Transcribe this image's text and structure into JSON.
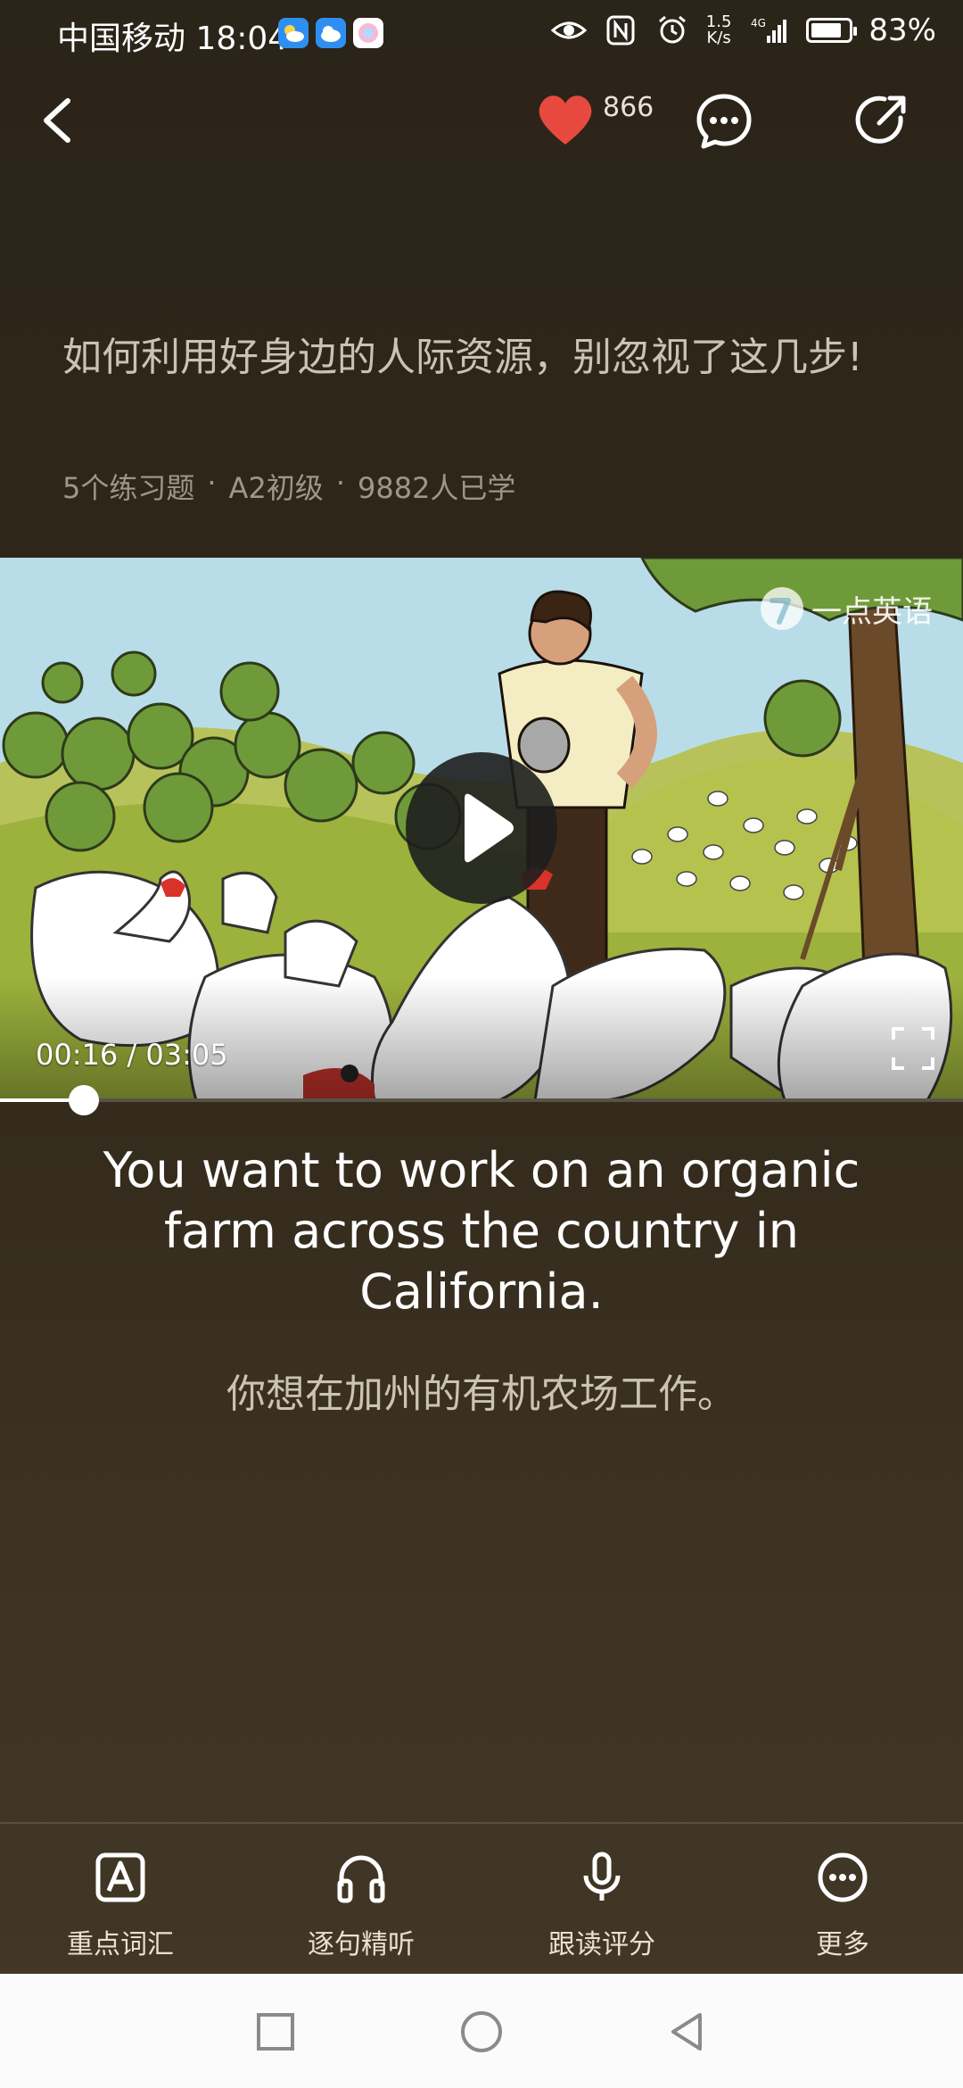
{
  "status_bar": {
    "carrier": "中国移动",
    "time": "18:04",
    "net_speed_value": "1.5",
    "net_speed_unit": "K/s",
    "battery_percent": "83%",
    "battery_level": 0.83,
    "icons": [
      "weather-app-icon",
      "cloud-app-icon",
      "photo-app-icon",
      "eye-icon",
      "nfc-icon",
      "alarm-icon",
      "signal-4g-icon",
      "battery-icon"
    ]
  },
  "header": {
    "like_count": "866",
    "colors": {
      "heart": "#e8493f"
    }
  },
  "lesson": {
    "title": "如何利用好身边的人际资源，别忽视了这几步!",
    "meta": [
      "5个练习题",
      "A2初级",
      "9882人已学"
    ],
    "meta_separator": "·"
  },
  "video": {
    "watermark": "一点英语",
    "current_time": "00:16",
    "duration": "03:05",
    "time_display": "00:16 / 03:05",
    "progress": 0.087
  },
  "subtitles": {
    "english": "You want to work on an organic farm across the country in California.",
    "chinese": "你想在加州的有机农场工作。"
  },
  "toolbar": {
    "items": [
      {
        "label": "重点词汇",
        "icon": "letter-a-icon"
      },
      {
        "label": "逐句精听",
        "icon": "headphones-icon"
      },
      {
        "label": "跟读评分",
        "icon": "microphone-icon"
      },
      {
        "label": "更多",
        "icon": "more-dots-icon"
      }
    ]
  }
}
